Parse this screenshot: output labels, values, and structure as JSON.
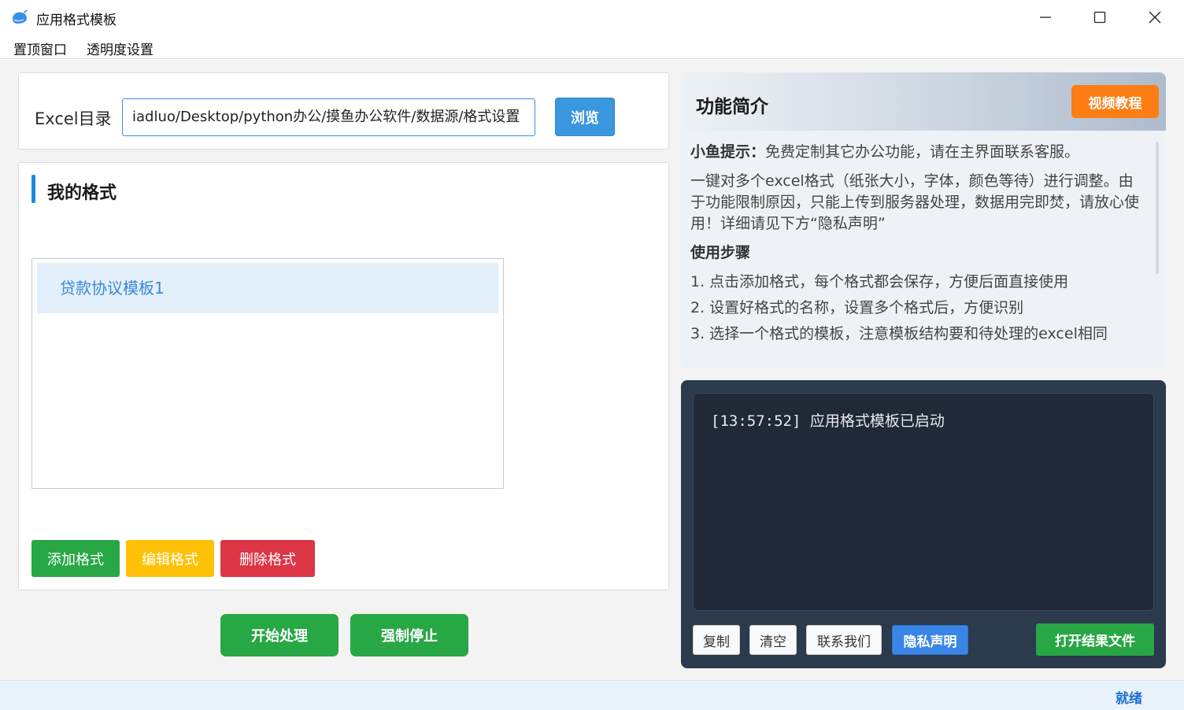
{
  "window": {
    "title": "应用格式模板",
    "icon": "whale-logo-icon",
    "controls": [
      "minimize-icon",
      "maximize-icon",
      "close-icon"
    ]
  },
  "menu": {
    "pin_window": "置顶窗口",
    "opacity_settings": "透明度设置"
  },
  "directory": {
    "label": "Excel目录",
    "value": "iadluo/Desktop/python办公/摸鱼办公软件/数据源/格式设置",
    "browse_label": "浏览"
  },
  "formats": {
    "title": "我的格式",
    "items": [
      "贷款协议模板1"
    ],
    "add_label": "添加格式",
    "edit_label": "编辑格式",
    "delete_label": "删除格式"
  },
  "actions": {
    "start_label": "开始处理",
    "stop_label": "强制停止"
  },
  "intro": {
    "title": "功能简介",
    "video_label": "视频教程",
    "tip_label": "小鱼提示：",
    "tip_text": "免费定制其它办公功能，请在主界面联系客服。",
    "description": "一键对多个excel格式（纸张大小，字体，颜色等待）进行调整。由于功能限制原因，只能上传到服务器处理，数据用完即焚，请放心使用！详细请见下方“隐私声明”",
    "steps_title": "使用步骤",
    "steps": [
      "1. 点击添加格式，每个格式都会保存，方便后面直接使用",
      "2. 设置好格式的名称，设置多个格式后，方便识别",
      "3. 选择一个格式的模板，注意模板结构要和待处理的excel相同"
    ]
  },
  "log": {
    "lines": [
      "[13:57:52] 应用格式模板已启动"
    ],
    "copy_label": "复制",
    "clear_label": "清空",
    "contact_label": "联系我们",
    "privacy_label": "隐私声明",
    "open_result_label": "打开结果文件"
  },
  "status": {
    "text": "就绪"
  },
  "colors": {
    "accent_blue": "#3a96dd",
    "green": "#28a745",
    "yellow": "#ffc107",
    "red": "#dc3545",
    "orange": "#fd7e14",
    "log_bg": "#2b3a4c"
  }
}
